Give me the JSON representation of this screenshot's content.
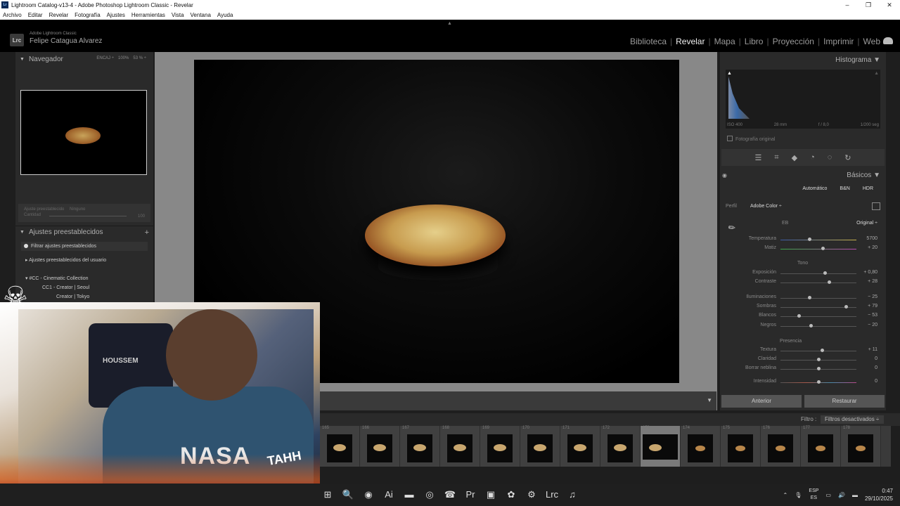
{
  "window": {
    "title": "Lightroom Catalog-v13-4 - Adobe Photoshop Lightroom Classic - Revelar",
    "controls": [
      "–",
      "❐",
      "✕"
    ]
  },
  "menu": [
    "Archivo",
    "Editar",
    "Revelar",
    "Fotografía",
    "Ajustes",
    "Herramientas",
    "Vista",
    "Ventana",
    "Ayuda"
  ],
  "identity": {
    "logo": "Lrc",
    "small": "Adobe Lightroom Classic",
    "name": "Felipe Catagua Alvarez"
  },
  "modules": [
    "Biblioteca",
    "Revelar",
    "Mapa",
    "Libro",
    "Proyección",
    "Imprimir",
    "Web"
  ],
  "active_module": "Revelar",
  "navigator": {
    "title": "Navegador",
    "opts": [
      "ENCAJ ÷",
      "100%",
      "53 % ÷"
    ]
  },
  "preset_amount": {
    "label1": "Ajuste preestablecido",
    "label2": "Ninguno",
    "label3": "Cantidad",
    "label4": "100"
  },
  "presets": {
    "title": "Ajustes preestablecidos",
    "filter": "Filtrar ajustes preestablecidos",
    "items": [
      "Ajustes preestablecidos del usuario",
      "#CC - Cinematic Collection",
      "CC1 - Creator | Seoul",
      "Creator | Tokyo"
    ]
  },
  "histogram": {
    "title": "Histograma",
    "iso": "ISO 400",
    "focal": "28 mm",
    "aperture": "f / 8,0",
    "shutter": "1/200 seg",
    "original": "Fotografía original"
  },
  "basic": {
    "title": "Básicos",
    "modes": [
      "Automático",
      "B&N",
      "HDR"
    ],
    "profile_label": "Perfil",
    "profile_value": "Adobe Color ÷",
    "wb_label": "EB",
    "wb_value": "Original ÷",
    "tone_label": "Tono",
    "presence_label": "Presencia"
  },
  "sliders": {
    "temperatura": {
      "label": "Temperatura",
      "value": "5700",
      "pos": 0.38
    },
    "matiz": {
      "label": "Matiz",
      "value": "+ 20",
      "pos": 0.56
    },
    "exposicion": {
      "label": "Exposición",
      "value": "+ 0,80",
      "pos": 0.58
    },
    "contraste": {
      "label": "Contraste",
      "value": "+ 28",
      "pos": 0.64
    },
    "iluminaciones": {
      "label": "Iluminaciones",
      "value": "− 25",
      "pos": 0.38
    },
    "sombras": {
      "label": "Sombras",
      "value": "+ 79",
      "pos": 0.86
    },
    "blancos": {
      "label": "Blancos",
      "value": "− 53",
      "pos": 0.24
    },
    "negros": {
      "label": "Negros",
      "value": "− 20",
      "pos": 0.4
    },
    "textura": {
      "label": "Textura",
      "value": "+ 11",
      "pos": 0.55
    },
    "claridad": {
      "label": "Claridad",
      "value": "0",
      "pos": 0.5
    },
    "borrar_neblina": {
      "label": "Borrar neblina",
      "value": "0",
      "pos": 0.5
    },
    "intensidad": {
      "label": "Intensidad",
      "value": "0",
      "pos": 0.5
    }
  },
  "buttons": {
    "previous": "Anterior",
    "reset": "Restaurar"
  },
  "filmstrip": {
    "filter_label": "Filtro :",
    "filter_value": "Filtros desactivados ÷",
    "cells": [
      "165",
      "166",
      "167",
      "168",
      "169",
      "170",
      "171",
      "172",
      "173",
      "174",
      "175",
      "176",
      "177",
      "178"
    ],
    "selected": "173"
  },
  "taskbar": {
    "apps": [
      "⊞",
      "🔍",
      "◉",
      "Ai",
      "▬",
      "◎",
      "☎",
      "Pr",
      "▣",
      "✿",
      "⚙",
      "Lrc",
      "♫"
    ],
    "lang1": "ESP",
    "lang2": "ES",
    "time": "0:47",
    "date": "29/10/2025"
  },
  "overlay": {
    "shirt_text": "NASA",
    "chair_text": "HOUSSEM",
    "sticker": "TAHH"
  }
}
